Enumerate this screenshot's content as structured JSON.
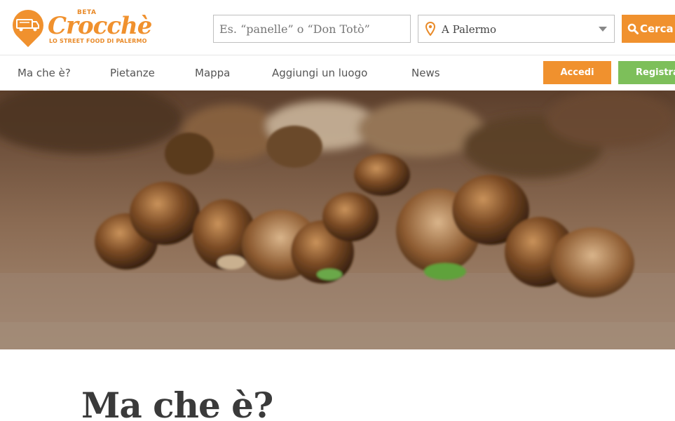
{
  "logo": {
    "beta": "BETA",
    "name": "Crocchè",
    "tagline": "LO STREET FOOD DI PALERMO",
    "icon": "food-truck-icon",
    "brand_color": "#f0912e"
  },
  "search": {
    "placeholder": "Es. “panelle” o “Don Totò”",
    "value": "",
    "button_label": "Cerca",
    "button_icon": "search-icon"
  },
  "location": {
    "icon": "map-pin-icon",
    "value": "A Palermo"
  },
  "nav": {
    "items": [
      {
        "label": "Ma che è?"
      },
      {
        "label": "Pietanze"
      },
      {
        "label": "Mappa"
      },
      {
        "label": "Aggiungi un luogo"
      },
      {
        "label": "News"
      }
    ],
    "login_label": "Accedi",
    "register_label": "Registrati",
    "login_color": "#f0912e",
    "register_color": "#7dbf5a"
  },
  "hero": {
    "image": "grilled-skewers-photo"
  },
  "content": {
    "title": "Ma che è?"
  }
}
